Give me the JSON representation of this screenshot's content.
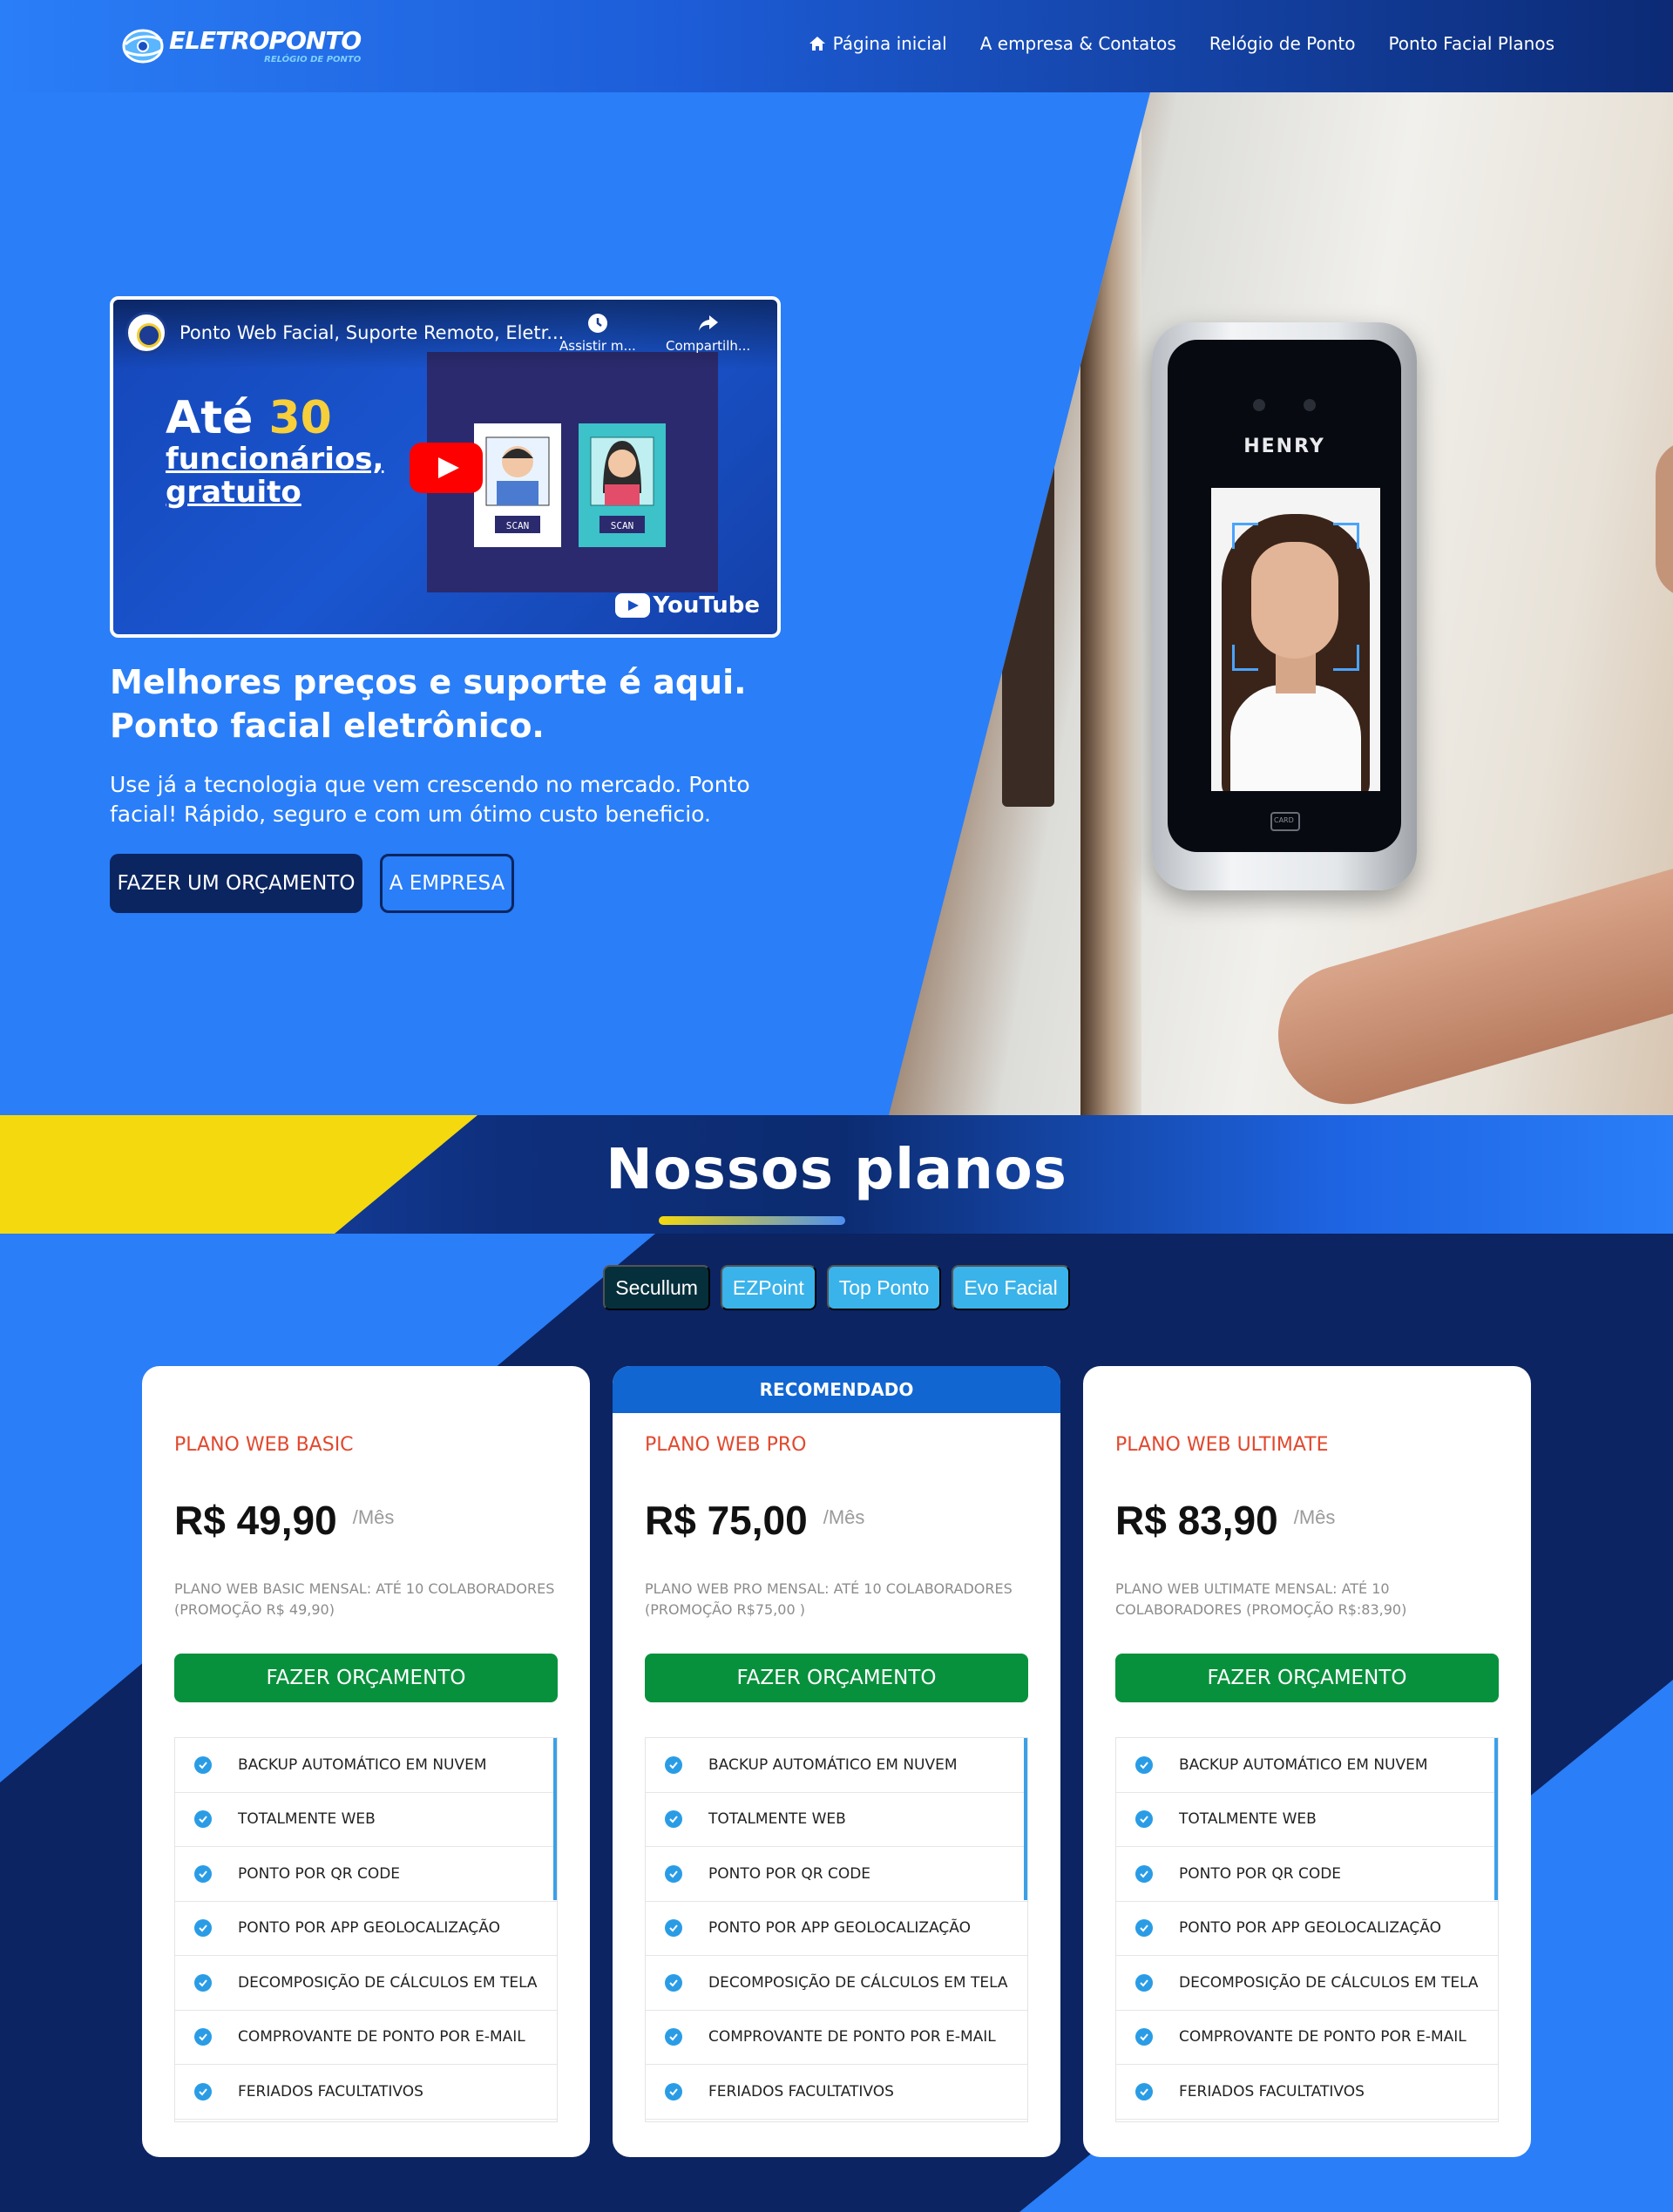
{
  "brand": {
    "title": "ELETROPONTO",
    "subtitle": "RELÓGIO DE PONTO"
  },
  "nav": {
    "items": [
      {
        "label": "Página inicial",
        "icon": "home-icon"
      },
      {
        "label": "A empresa & Contatos"
      },
      {
        "label": "Relógio de Ponto"
      },
      {
        "label": "Ponto Facial Planos"
      }
    ]
  },
  "hero": {
    "video": {
      "title": "Ponto Web Facial, Suporte Remoto, Eletr...",
      "watch_label": "Assistir m...",
      "share_label": "Compartilh...",
      "headline_prefix": "Até ",
      "headline_number": "30",
      "headline_rest": "funcionários,",
      "headline_last": "gratuito",
      "card1_label": "SCAN",
      "card2_label": "SCAN",
      "youtube_label": "YouTube"
    },
    "device_brand": "HENRY",
    "device_card_label": "CARD",
    "heading": "Melhores preços e suporte é aqui. Ponto facial eletrônico.",
    "text": "Use já a tecnologia que vem crescendo no mercado. Ponto facial! Rápido, seguro e com um ótimo custo beneficio.",
    "primary_button": "FAZER UM ORÇAMENTO",
    "secondary_button": "A EMPRESA"
  },
  "plans": {
    "title": "Nossos planos",
    "tabs": [
      "Secullum",
      "EZPoint",
      "Top Ponto",
      "Evo Facial"
    ],
    "active_tab": "Secullum",
    "colors": {
      "accent_yellow": "#f4d90e",
      "primary_blue": "#2a7ef8",
      "navy": "#0c2462",
      "button_green": "#08913c",
      "plan_name_red": "#e2482e"
    },
    "cards": [
      {
        "ribbon": "",
        "name": "PLANO WEB BASIC",
        "price": "R$ 49,90",
        "unit": "/Mês",
        "desc": "PLANO WEB BASIC MENSAL: ATÉ 10 COLABORADORES (PROMOÇÃO R$ 49,90)",
        "button": "FAZER ORÇAMENTO"
      },
      {
        "ribbon": "RECOMENDADO",
        "name": "PLANO WEB PRO",
        "price": "R$ 75,00",
        "unit": "/Mês",
        "desc": "PLANO WEB PRO MENSAL: ATÉ 10 COLABORADORES (PROMOÇÃO R$75,00 )",
        "button": "FAZER ORÇAMENTO"
      },
      {
        "ribbon": "",
        "name": "PLANO WEB ULTIMATE",
        "price": "R$ 83,90",
        "unit": "/Mês",
        "desc": "PLANO WEB ULTIMATE MENSAL: ATÉ 10 COLABORADORES (PROMOÇÃO R$:83,90)",
        "button": "FAZER ORÇAMENTO"
      }
    ],
    "features": [
      "BACKUP AUTOMÁTICO EM NUVEM",
      "TOTALMENTE WEB",
      "PONTO POR QR CODE",
      "PONTO POR APP GEOLOCALIZAÇÃO",
      "DECOMPOSIÇÃO DE CÁLCULOS EM TELA",
      "COMPROVANTE DE PONTO POR E-MAIL",
      "FERIADOS FACULTATIVOS"
    ]
  }
}
